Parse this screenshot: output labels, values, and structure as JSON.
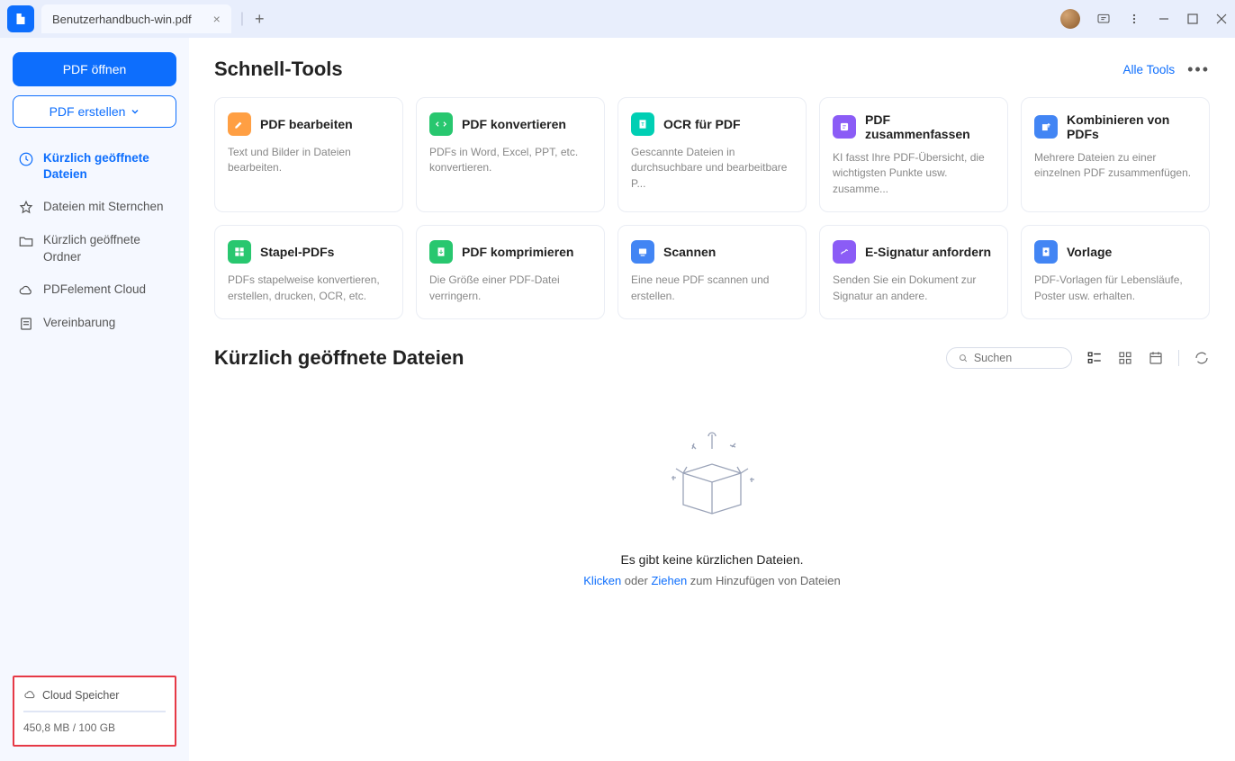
{
  "titlebar": {
    "tab_name": "Benutzerhandbuch-win.pdf"
  },
  "sidebar": {
    "open_btn": "PDF öffnen",
    "create_btn": "PDF erstellen",
    "items": [
      "Kürzlich geöffnete Dateien",
      "Dateien mit Sternchen",
      "Kürzlich geöffnete Ordner",
      "PDFelement Cloud",
      "Vereinbarung"
    ],
    "cloud": {
      "title": "Cloud Speicher",
      "usage": "450,8 MB / 100 GB"
    }
  },
  "main": {
    "quick_title": "Schnell-Tools",
    "all_tools": "Alle Tools",
    "tools": [
      {
        "title": "PDF bearbeiten",
        "desc": "Text und Bilder in Dateien bearbeiten."
      },
      {
        "title": "PDF konvertieren",
        "desc": "PDFs in Word, Excel, PPT, etc. konvertieren."
      },
      {
        "title": "OCR für PDF",
        "desc": "Gescannte Dateien in durchsuchbare und bearbeitbare P..."
      },
      {
        "title": "PDF zusammenfassen",
        "desc": "KI fasst Ihre PDF-Übersicht, die wichtigsten Punkte usw. zusamme..."
      },
      {
        "title": "Kombinieren von PDFs",
        "desc": "Mehrere Dateien zu einer einzelnen PDF zusammenfügen."
      },
      {
        "title": "Stapel-PDFs",
        "desc": "PDFs stapelweise konvertieren, erstellen, drucken, OCR, etc."
      },
      {
        "title": "PDF komprimieren",
        "desc": "Die Größe einer PDF-Datei verringern."
      },
      {
        "title": "Scannen",
        "desc": "Eine neue PDF scannen und erstellen."
      },
      {
        "title": "E-Signatur anfordern",
        "desc": "Senden Sie ein Dokument zur Signatur an andere."
      },
      {
        "title": "Vorlage",
        "desc": "PDF-Vorlagen für Lebensläufe, Poster usw. erhalten."
      }
    ],
    "recent_title": "Kürzlich geöffnete Dateien",
    "search_placeholder": "Suchen",
    "empty_text": "Es gibt keine kürzlichen Dateien.",
    "empty_click": "Klicken",
    "empty_or": " oder ",
    "empty_drag": "Ziehen",
    "empty_tail": " zum Hinzufügen von Dateien"
  }
}
